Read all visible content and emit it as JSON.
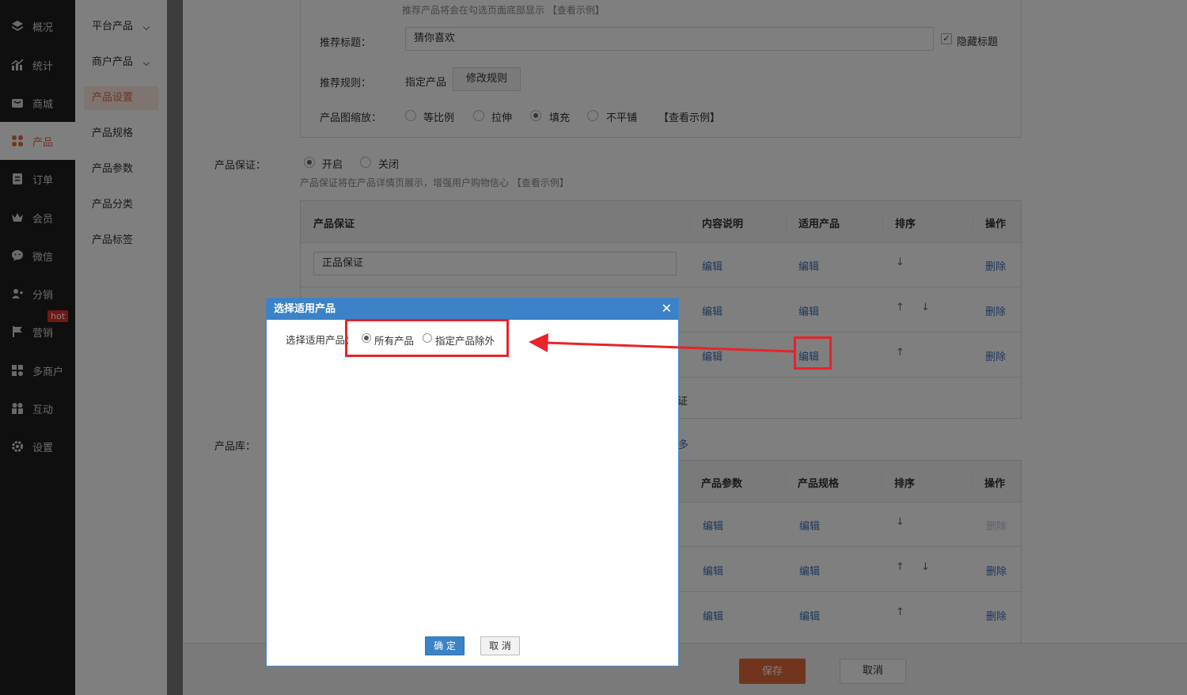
{
  "nav": {
    "items": [
      {
        "label": "概况",
        "icon": "layers-icon"
      },
      {
        "label": "统计",
        "icon": "stats-icon"
      },
      {
        "label": "商城",
        "icon": "shop-icon"
      },
      {
        "label": "产品",
        "icon": "product-icon",
        "active": true
      },
      {
        "label": "订单",
        "icon": "order-icon"
      },
      {
        "label": "会员",
        "icon": "crown-icon"
      },
      {
        "label": "微信",
        "icon": "wechat-icon"
      },
      {
        "label": "分销",
        "icon": "distribute-icon"
      },
      {
        "label": "营销",
        "icon": "flag-icon"
      },
      {
        "label": "多商户",
        "icon": "merchant-icon"
      },
      {
        "label": "互动",
        "icon": "interact-icon"
      },
      {
        "label": "设置",
        "icon": "gear-icon"
      }
    ],
    "hot_badge": "hot"
  },
  "subnav": {
    "items": [
      {
        "label": "平台产品"
      },
      {
        "label": "商户产品"
      },
      {
        "label": "产品设置"
      },
      {
        "label": "产品规格"
      },
      {
        "label": "产品参数"
      },
      {
        "label": "产品分类"
      },
      {
        "label": "产品标签"
      }
    ]
  },
  "recommend": {
    "hint": "推荐产品将会在勾选页面底部显示 【查看示例】",
    "title_label": "推荐标题：",
    "title_value": "猜你喜欢",
    "hide_title_label": "隐藏标题",
    "rule_label": "推荐规则：",
    "rule_value": "指定产品",
    "rule_button": "修改规则",
    "scale_label": "产品图缩放：",
    "scale_options": [
      "等比例",
      "拉伸",
      "填充",
      "不平铺"
    ],
    "scale_selected": "填充",
    "scale_example": "【查看示例】"
  },
  "guarantee": {
    "label": "产品保证：",
    "options": [
      "开启",
      "关闭"
    ],
    "selected": "开启",
    "hint": "产品保证将在产品详情页展示，增强用户购物信心 【查看示例】",
    "headers": [
      "产品保证",
      "内容说明",
      "适用产品",
      "排序",
      "操作"
    ],
    "row1_name": "正品保证",
    "edit": "编辑",
    "delete": "删除",
    "partial_text": "证"
  },
  "library": {
    "label": "产品库：",
    "partial_text": "多",
    "headers": [
      "产品参数",
      "产品规格",
      "排序",
      "操作"
    ],
    "edit": "编辑",
    "delete": "删除"
  },
  "footer": {
    "save": "保存",
    "cancel": "取消"
  },
  "modal": {
    "title": "选择适用产品",
    "field_label": "选择适用产品：",
    "options": [
      "所有产品",
      "指定产品除外"
    ],
    "selected": "所有产品",
    "confirm": "确 定",
    "cancel": "取 消"
  },
  "colors": {
    "accent": "#e36a3d",
    "link": "#3c6fb8",
    "modal_header": "#3b82c8",
    "annotation": "#e8232a"
  }
}
